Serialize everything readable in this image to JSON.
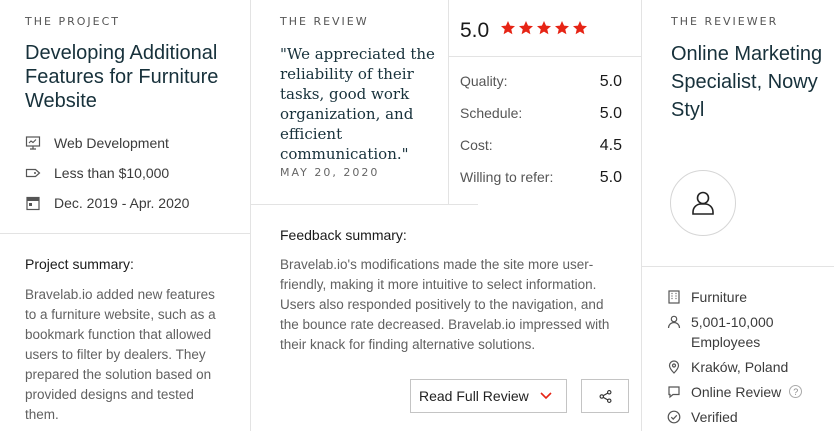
{
  "project": {
    "eyebrow": "THE PROJECT",
    "title": "Developing Additional Features for Furniture Website",
    "service": "Web Development",
    "budget": "Less than $10,000",
    "dates": "Dec. 2019 - Apr. 2020",
    "summary_label": "Project summary:",
    "summary_text": "Bravelab.io added new features to a furniture website, such as a bookmark function that allowed users to filter by dealers. They prepared the solution based on provided designs and tested them."
  },
  "review": {
    "eyebrow": "THE REVIEW",
    "quote": "\"We appreciated the reliability of their tasks, good work organization, and efficient communication.\"",
    "date": "MAY 20, 2020",
    "overall": "5.0",
    "stars": 5,
    "star_color": "#e62415",
    "ratings": [
      {
        "label": "Quality:",
        "value": "5.0"
      },
      {
        "label": "Schedule:",
        "value": "5.0"
      },
      {
        "label": "Cost:",
        "value": "4.5"
      },
      {
        "label": "Willing to refer:",
        "value": "5.0"
      }
    ],
    "feedback_label": "Feedback summary:",
    "feedback_text": "Bravelab.io's modifications made the site more user-friendly, making it more intuitive to select information. Users also responded positively to the navigation, and the bounce rate decreased. Bravelab.io impressed with their knack for finding alternative solutions.",
    "read_full_label": "Read Full Review"
  },
  "reviewer": {
    "eyebrow": "THE REVIEWER",
    "title": "Online Marketing Specialist, Nowy Styl",
    "industry": "Furniture",
    "employees": "5,001-10,000 Employees",
    "location": "Kraków, Poland",
    "review_type": "Online Review",
    "help_glyph": "?",
    "verified": "Verified"
  }
}
